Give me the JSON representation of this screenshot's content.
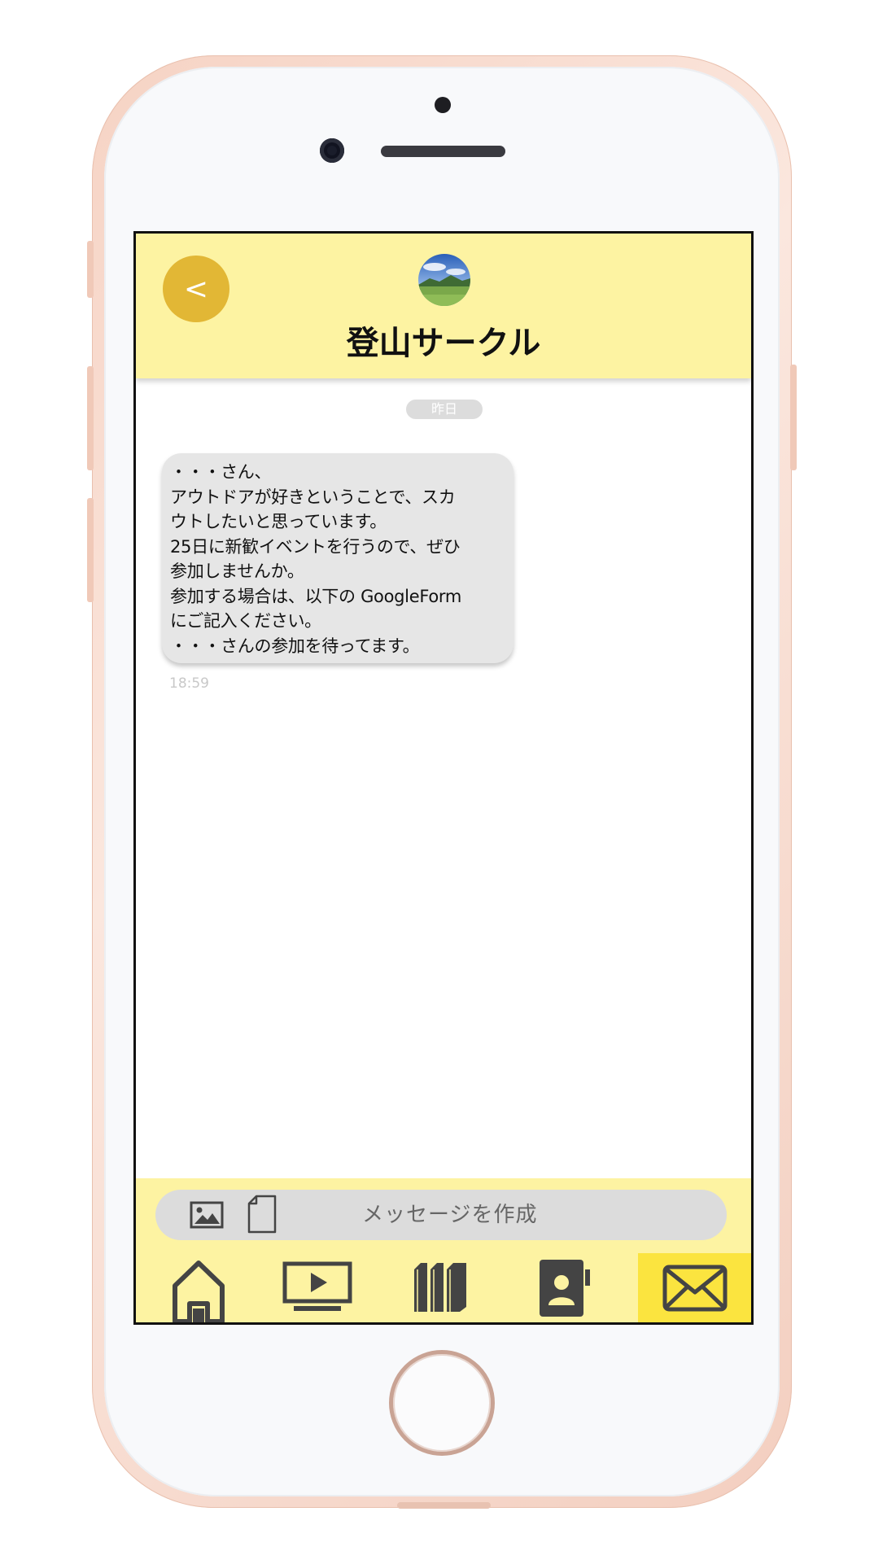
{
  "header": {
    "back_label": "<",
    "title": "登山サークル",
    "avatar": "mountain-landscape-photo"
  },
  "chat": {
    "date_divider": "昨日",
    "messages": [
      {
        "lines": [
          "・・・さん、",
          "アウトドアが好きということで、スカ",
          "ウトしたいと思っています。",
          "25日に新歓イベントを行うので、ぜひ",
          "参加しませんか。",
          "参加する場合は、以下の GoogleForm",
          "にご記入ください。",
          "・・・さんの参加を待ってます。"
        ],
        "time": "18:59"
      }
    ]
  },
  "composer": {
    "placeholder": "メッセージを作成",
    "icons": [
      "image-icon",
      "file-icon"
    ]
  },
  "tabbar": {
    "items": [
      {
        "icon": "home-icon",
        "active": false
      },
      {
        "icon": "video-icon",
        "active": false
      },
      {
        "icon": "books-icon",
        "active": false
      },
      {
        "icon": "contacts-icon",
        "active": false
      },
      {
        "icon": "mail-icon",
        "active": true
      }
    ]
  },
  "colors": {
    "header_bg": "#fdf3a2",
    "back_button": "#e2b735",
    "active_tab": "#fbe43f",
    "bubble": "#e6e6e6",
    "icon": "#444444"
  }
}
